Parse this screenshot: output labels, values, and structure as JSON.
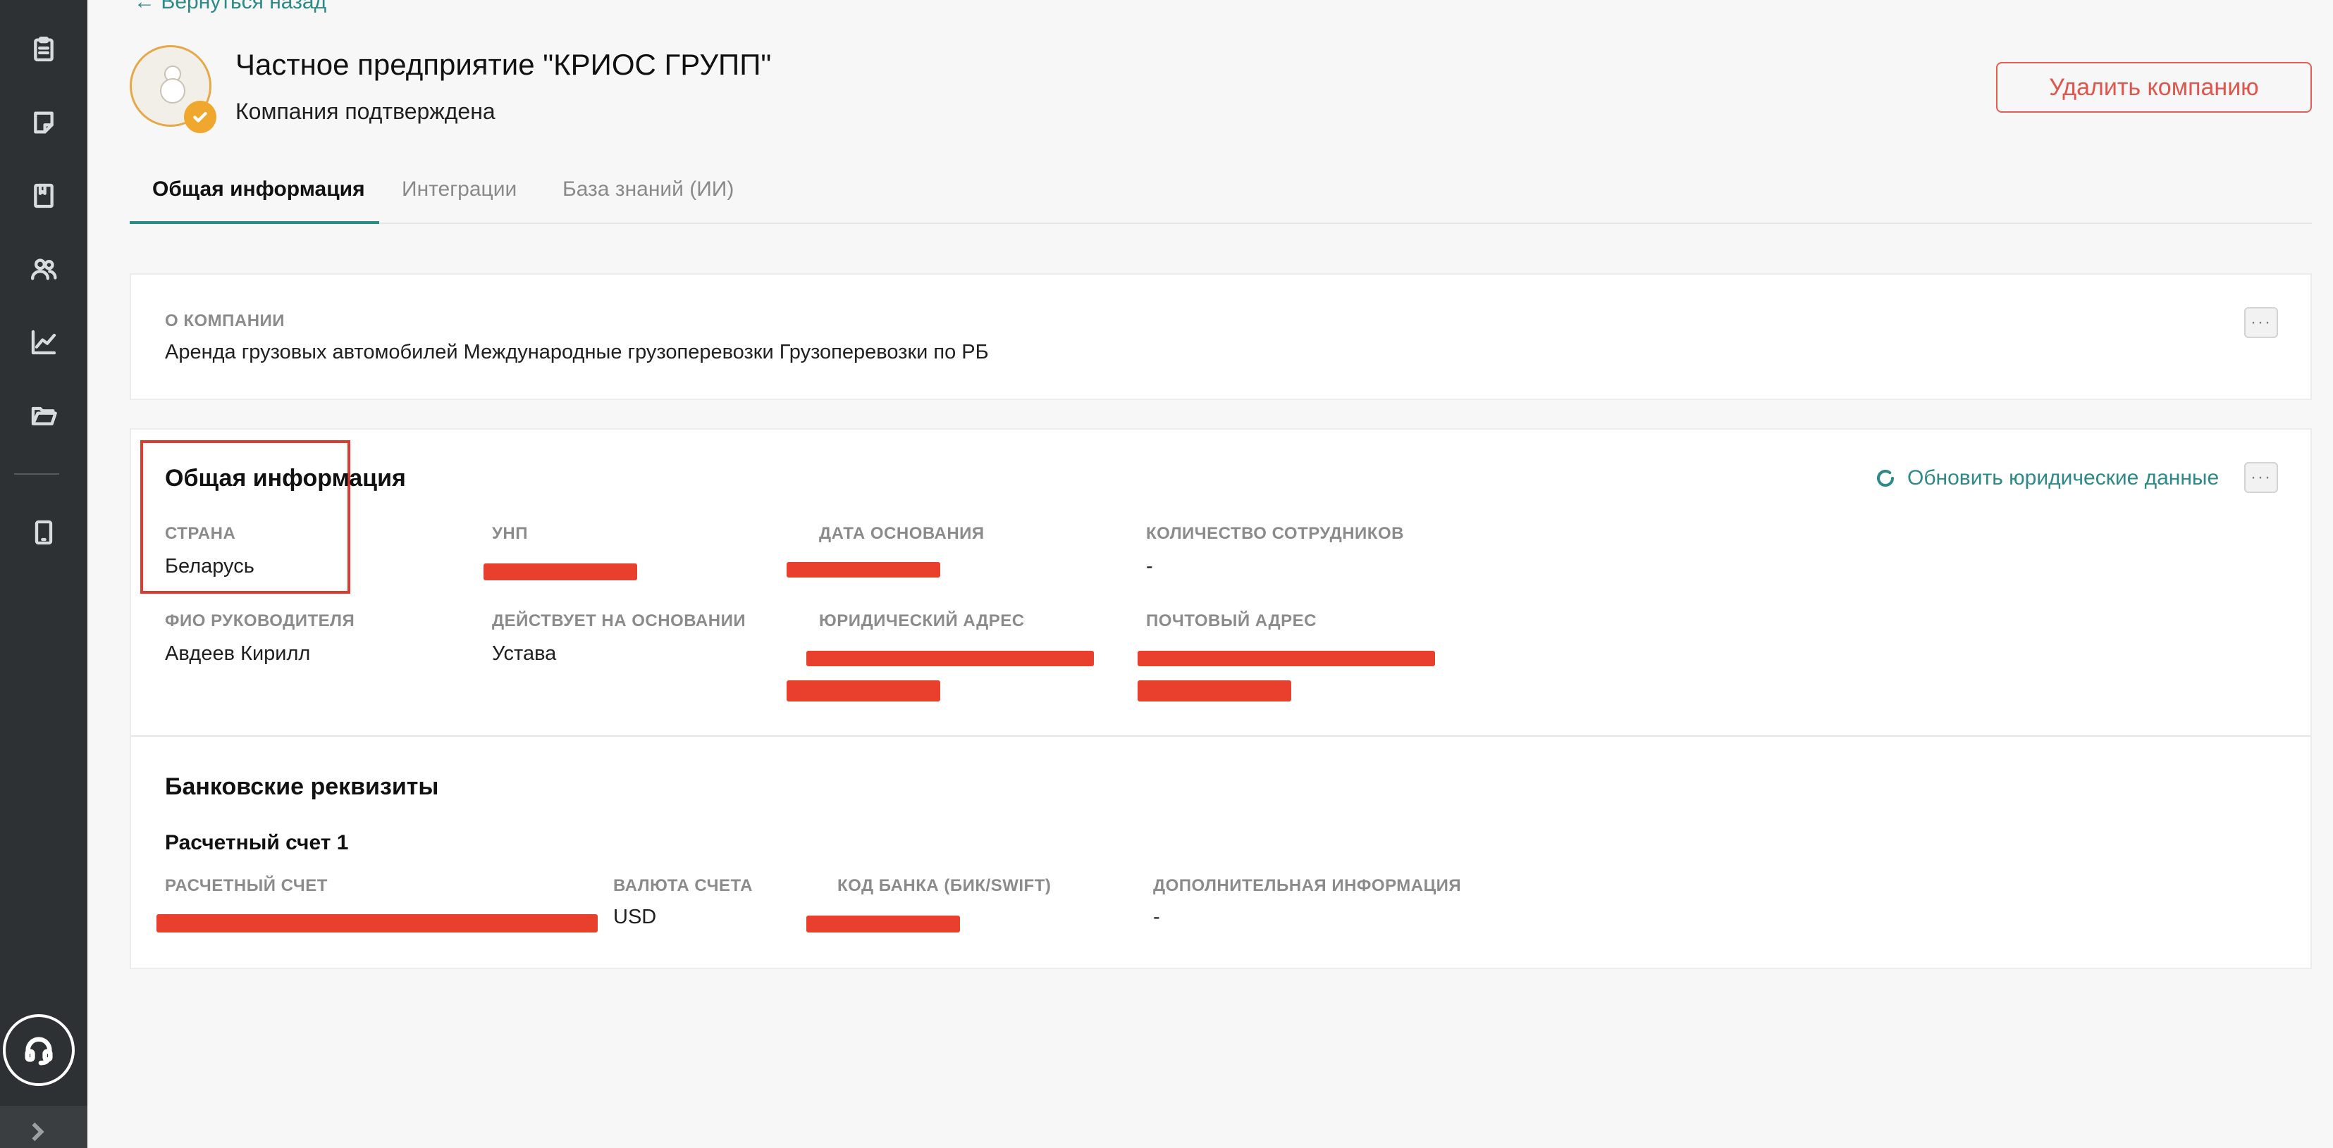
{
  "header": {
    "back_link": "← Вернуться назад",
    "company_name": "Частное предприятие \"КРИОС ГРУПП\"",
    "status": "Компания подтверждена",
    "delete_button": "Удалить компанию"
  },
  "tabs": [
    {
      "label": "Общая информация",
      "active": true
    },
    {
      "label": "Интеграции",
      "active": false
    },
    {
      "label": "База знаний (ИИ)",
      "active": false
    }
  ],
  "about": {
    "label": "О компании",
    "text": "Аренда грузовых автомобилей Международные грузоперевозки Грузоперевозки по РБ",
    "more_button": "···"
  },
  "general": {
    "title": "Общая информация",
    "refresh_button": "Обновить юридические данные",
    "more_button": "···",
    "fields": {
      "country": {
        "label": "Страна",
        "value": "Беларусь"
      },
      "unp": {
        "label": "УНП",
        "value": ""
      },
      "founded": {
        "label": "Дата основания",
        "value": ""
      },
      "employees": {
        "label": "Количество сотрудников",
        "value": "-"
      },
      "director": {
        "label": "ФИО руководителя",
        "value": "Авдеев Кирилл"
      },
      "basis": {
        "label": "Действует на основании",
        "value": "Устава"
      },
      "legal_address": {
        "label": "Юридический адрес",
        "value": ""
      },
      "postal_address": {
        "label": "Почтовый адрес",
        "value": ""
      }
    }
  },
  "bank": {
    "title": "Банковские реквизиты",
    "account_title": "Расчетный счет 1",
    "fields": {
      "account": {
        "label": "Расчетный счет",
        "value": ""
      },
      "currency": {
        "label": "Валюта счета",
        "value": "USD"
      },
      "bank_code": {
        "label": "Код банка (БИК/SWIFT)",
        "value": ""
      },
      "extra": {
        "label": "Дополнительная информация",
        "value": "-"
      }
    }
  },
  "colors": {
    "accent": "#2c8a87",
    "danger": "#e0554c",
    "sidebar": "#2d3133",
    "redaction": "#e8402d"
  },
  "icons": {
    "sidebar": [
      "clipboard-icon",
      "note-icon",
      "book-icon",
      "users-icon",
      "chart-icon",
      "folder-icon",
      "tablet-icon"
    ],
    "support": "headset-icon",
    "expand": "chevron-right-icon"
  }
}
